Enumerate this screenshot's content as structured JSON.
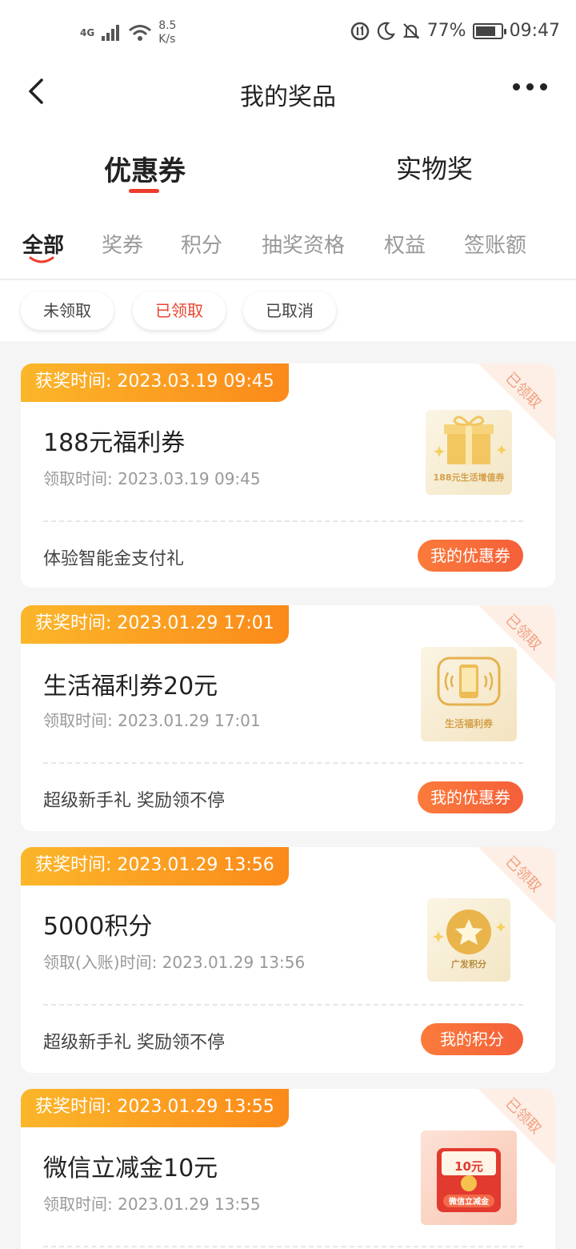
{
  "status_bar": {
    "network": "4G",
    "speed": "8.5",
    "speed_unit": "K/s",
    "battery": "77%",
    "time": "09:47"
  },
  "header": {
    "title": "我的奖品"
  },
  "main_tabs": [
    {
      "label": "优惠券",
      "active": true
    },
    {
      "label": "实物奖",
      "active": false
    }
  ],
  "sub_tabs": [
    {
      "label": "全部",
      "active": true
    },
    {
      "label": "奖券",
      "active": false
    },
    {
      "label": "积分",
      "active": false
    },
    {
      "label": "抽奖资格",
      "active": false
    },
    {
      "label": "权益",
      "active": false
    },
    {
      "label": "签账额",
      "active": false
    }
  ],
  "filters": [
    {
      "label": "未领取",
      "active": false
    },
    {
      "label": "已领取",
      "active": true
    },
    {
      "label": "已取消",
      "active": false
    }
  ],
  "colors": {
    "accent": "#ee3b2a",
    "ribbon_start": "#fbb62a",
    "ribbon_end": "#fb8a1a",
    "button": "#f45f3a"
  },
  "cards": [
    {
      "award_time": "获奖时间: 2023.03.19 09:45",
      "corner_badge": "已领取",
      "title": "188元福利券",
      "time": "领取时间: 2023.03.19 09:45",
      "desc": "体验智能金支付礼",
      "button": "我的优惠券",
      "thumb_label": "188元生活增值券",
      "thumb_icon": "gift-icon"
    },
    {
      "award_time": "获奖时间: 2023.01.29 17:01",
      "corner_badge": "已领取",
      "title": "生活福利券20元",
      "time": "领取时间: 2023.01.29 17:01",
      "desc": "超级新手礼 奖励领不停",
      "button": "我的优惠券",
      "thumb_label": "生活福利券",
      "thumb_icon": "phone-icon"
    },
    {
      "award_time": "获奖时间: 2023.01.29 13:56",
      "corner_badge": "已领取",
      "title": "5000积分",
      "time": "领取(入账)时间: 2023.01.29 13:56",
      "desc": "超级新手礼 奖励领不停",
      "button": "我的积分",
      "thumb_label": "广发积分",
      "thumb_icon": "star-icon"
    },
    {
      "award_time": "获奖时间: 2023.01.29 13:55",
      "corner_badge": "已领取",
      "title": "微信立减金10元",
      "time": "领取时间: 2023.01.29 13:55",
      "thumb_label": "微信立减金",
      "thumb_amount": "10元",
      "thumb_icon": "red-envelope-icon"
    }
  ]
}
